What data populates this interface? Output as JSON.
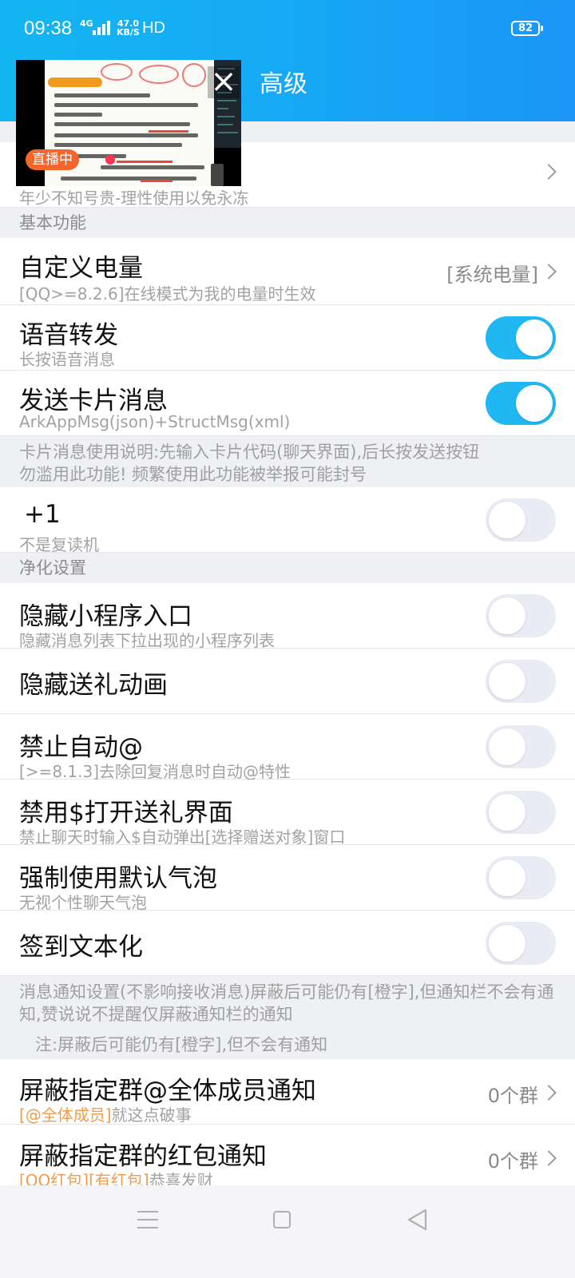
{
  "status_bar": {
    "time": "09:38",
    "network": "4G",
    "speed_value": "47.0",
    "speed_unit": "KB/S",
    "hd": "HD",
    "battery": "82"
  },
  "header": {
    "title": "高级",
    "background_color": "#16a9f5"
  },
  "live_video": {
    "badge": "直播中",
    "close_icon": "close-icon"
  },
  "partial_row": {
    "subtitle": "年少不知号贵-理性使用以免永冻"
  },
  "sections": {
    "basic": "基本功能",
    "purify": "净化设置"
  },
  "rows": {
    "custom_battery": {
      "title": "自定义电量",
      "subtitle": "[QQ>=8.2.6]在线模式为我的电量时生效",
      "value": "[系统电量]"
    },
    "voice_forward": {
      "title": "语音转发",
      "subtitle": "长按语音消息",
      "on": true
    },
    "card_message": {
      "title": "发送卡片消息",
      "subtitle": "ArkAppMsg(json)+StructMsg(xml)",
      "on": true
    },
    "plus_one": {
      "title": "+1",
      "subtitle": "不是复读机",
      "on": false
    },
    "hide_miniapp": {
      "title": "隐藏小程序入口",
      "subtitle": "隐藏消息列表下拉出现的小程序列表",
      "on": false
    },
    "hide_gift_anim": {
      "title": "隐藏送礼动画",
      "on": false
    },
    "no_auto_at": {
      "title": "禁止自动@",
      "subtitle": "[>=8.1.3]去除回复消息时自动@特性",
      "on": false
    },
    "no_dollar_gift": {
      "title": "禁用$打开送礼界面",
      "subtitle": "禁止聊天时输入$自动弹出[选择赠送对象]窗口",
      "on": false
    },
    "default_bubble": {
      "title": "强制使用默认气泡",
      "subtitle": "无视个性聊天气泡",
      "on": false
    },
    "signin_text": {
      "title": "签到文本化",
      "on": false
    },
    "block_at_all": {
      "title": "屏蔽指定群@全体成员通知",
      "subtitle_highlight": "[@全体成员]",
      "subtitle_rest": "就这点破事",
      "value": "0个群"
    },
    "block_red_packet": {
      "title": "屏蔽指定群的红包通知",
      "subtitle_highlight": "[QQ红包][有红包]",
      "subtitle_rest": "恭喜发财",
      "value": "0个群"
    }
  },
  "notes": {
    "card_line1": "卡片消息使用说明:先输入卡片代码(聊天界面),后长按发送按钮",
    "card_line2": "勿滥用此功能! 频繁使用此功能被举报可能封号",
    "notify_line1": "消息通知设置(不影响接收消息)屏蔽后可能仍有[橙字],但通知栏不会有通",
    "notify_line2": "知,赞说说不提醒仅屏蔽通知栏的通知",
    "notify_indent": "注:屏蔽后可能仍有[橙字],但不会有通知"
  },
  "colors": {
    "toggle_on": "#1fb8f3",
    "toggle_off": "#e9ebf5",
    "highlight": "#f49b4b"
  }
}
